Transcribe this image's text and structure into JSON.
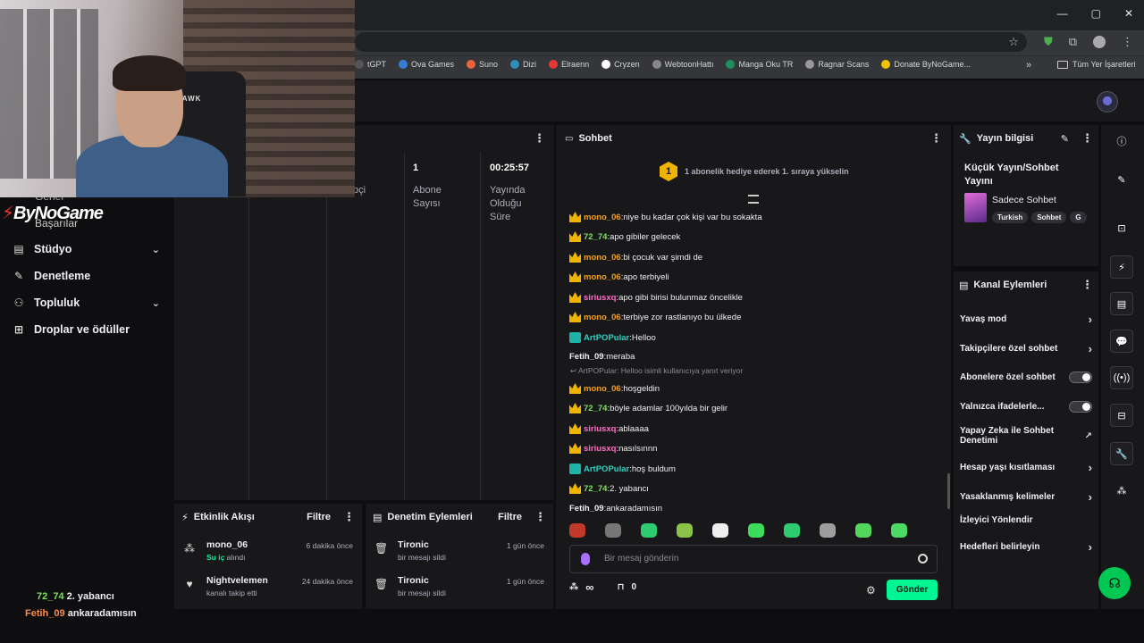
{
  "browser": {
    "win_controls": [
      "—",
      "▢",
      "✕"
    ],
    "bookmarks": [
      {
        "label": "tGPT",
        "color": "#555"
      },
      {
        "label": "Ova Games",
        "color": "#3a7bd5"
      },
      {
        "label": "Suno",
        "color": "#e8643c"
      },
      {
        "label": "Dizi",
        "color": "#2a8fbd"
      },
      {
        "label": "Elraenn",
        "color": "#e53935"
      },
      {
        "label": "Cryzen",
        "color": "#ffffff"
      },
      {
        "label": "WebtoonHattı",
        "color": "#888"
      },
      {
        "label": "Manga Oku TR",
        "color": "#1e8f5e"
      },
      {
        "label": "Ragnar Scans",
        "color": "#999"
      },
      {
        "label": "Donate ByNoGame...",
        "color": "#f2c200"
      }
    ],
    "more": "»",
    "all_bookmarks": "Tüm Yer İşaretleri"
  },
  "webcam": {
    "chair_text": "HAWK"
  },
  "sidebar": {
    "logo": "ByNoGame",
    "cutoff_top": "Genel",
    "cutoff_label": "Başarılar",
    "items": [
      {
        "label": "Stüdyo",
        "icon": "film-icon",
        "glyph": "▤",
        "expand": true
      },
      {
        "label": "Denetleme",
        "icon": "wrench-icon",
        "glyph": "🔧",
        "expand": false
      },
      {
        "label": "Topluluk",
        "icon": "people-icon",
        "glyph": "👥",
        "expand": true
      },
      {
        "label": "Droplar ve ödüller",
        "icon": "gift-icon",
        "glyph": "🎁",
        "expand": false
      }
    ]
  },
  "stats": {
    "col1_label": "pçi",
    "subs_value": "1",
    "subs_label": [
      "Abone",
      "Sayısı"
    ],
    "time_value": "00:25:57",
    "time_label": [
      "Yayında",
      "Olduğu",
      "Süre"
    ]
  },
  "chat": {
    "title": "Sohbet",
    "hype_level": "1",
    "hype_text": "1 abonelik hediye ederek 1. sıraya yükselin",
    "messages": [
      {
        "user": "mono_06",
        "color": "#f0a020",
        "badge": "crown",
        "text": "niye bu kadar çok kişi var bu sokakta"
      },
      {
        "user": "72_74",
        "color": "#7ee35a",
        "badge": "crown",
        "text": "apo gibiler gelecek"
      },
      {
        "user": "mono_06",
        "color": "#f0a020",
        "badge": "crown",
        "text": "bi çocuk var şimdi de"
      },
      {
        "user": "mono_06",
        "color": "#f0a020",
        "badge": "crown",
        "text": "apo terbiyeli"
      },
      {
        "user": "siriusxq",
        "color": "#ff6ec7",
        "badge": "crown",
        "text": "apo gibi birisi bulunmaz öncelikle"
      },
      {
        "user": "mono_06",
        "color": "#f0a020",
        "badge": "crown",
        "text": "terbiye zor rastlanıyo bu ülkede"
      },
      {
        "user": "ArtPOPular",
        "color": "#29d3c6",
        "badge": "artist",
        "text": "Helloo"
      },
      {
        "user": "Fetih_09",
        "color": "#efeff1",
        "badge": "",
        "text": "meraba"
      },
      {
        "user": "mono_06",
        "color": "#f0a020",
        "badge": "crown",
        "text": "hoşgeldin"
      },
      {
        "user": "72_74",
        "color": "#7ee35a",
        "badge": "crown",
        "text": "böyle adamlar 100yılda bir gelir"
      },
      {
        "user": "siriusxq",
        "color": "#ff6ec7",
        "badge": "crown",
        "text": "ablaaaa"
      },
      {
        "user": "siriusxq",
        "color": "#ff6ec7",
        "badge": "crown",
        "text": "nasılsınnn"
      },
      {
        "user": "ArtPOPular",
        "color": "#29d3c6",
        "badge": "artist",
        "text": "hoş buldum"
      },
      {
        "user": "72_74",
        "color": "#7ee35a",
        "badge": "crown",
        "text": "2. yabancı"
      },
      {
        "user": "Fetih_09",
        "color": "#efeff1",
        "badge": "",
        "text": "ankaradamısın"
      }
    ],
    "reply_hint": "↩ ArtPOPular: Helloo isimli kullanıcıya yanıt veriyor",
    "emote_colors": [
      "#c0392b",
      "#777",
      "#2ecc71",
      "#8bc34a",
      "#eeeeee",
      "#3ddc5a",
      "#2ecc71",
      "#9e9e9e",
      "#52d65c",
      "#4cd964"
    ],
    "input_placeholder": "Bir mesaj gönderin",
    "points": "∞",
    "drops": "0",
    "send_label": "Gönder"
  },
  "stream_info": {
    "title": "Yayın bilgisi",
    "stream_title": "Küçük Yayın/Sohbet Yayını",
    "category": "Sadece Sohbet",
    "tags": [
      "Turkish",
      "Sohbet",
      "G"
    ]
  },
  "channel_actions": {
    "title": "Kanal Eylemleri",
    "items": [
      {
        "label": "Yavaş mod",
        "control": "chevron"
      },
      {
        "label": "Takipçilere özel sohbet",
        "control": "chevron"
      },
      {
        "label": "Abonelere özel sohbet",
        "control": "toggle"
      },
      {
        "label": "Yalnızca ifadelerle...",
        "control": "toggle"
      },
      {
        "label": "Yapay Zeka ile Sohbet Denetimi",
        "control": "external"
      },
      {
        "label": "Hesap yaşı kısıtlaması",
        "control": "chevron"
      },
      {
        "label": "Yasaklanmış kelimeler",
        "control": "chevron"
      },
      {
        "label": "İzleyici Yönlendir",
        "control": "none"
      },
      {
        "label": "Hedefleri belirleyin",
        "control": "chevron"
      }
    ]
  },
  "activity": {
    "title": "Etkinlik Akışı",
    "filter": "Filtre",
    "items": [
      {
        "name": "mono_06",
        "sub_highlight": "Su iç",
        "sub": " alındı",
        "time": "6 dakika önce"
      },
      {
        "name": "Nightvelemen",
        "sub_highlight": "",
        "sub": "kanalı takip etti",
        "time": "24 dakika önce"
      }
    ]
  },
  "moderation": {
    "title": "Denetim Eylemleri",
    "filter": "Filtre",
    "items": [
      {
        "name": "Tironic",
        "sub": "bir mesajı sildi",
        "time": "1 gün önce"
      },
      {
        "name": "Tironic",
        "sub": "bir mesajı sildi",
        "time": "1 gün önce"
      }
    ]
  },
  "overlay_chat": [
    {
      "user": "72_74",
      "color": "#7ee35a",
      "text": "2. yabancı"
    },
    {
      "user": "Fetih_09",
      "color": "#ff8c42",
      "text": "ankaradamısın"
    }
  ],
  "rail": {
    "buttons": [
      "ⓘ",
      "✎",
      "⊡",
      "⚡",
      "▤",
      "💬",
      "((•))",
      "⊟",
      "🔧",
      "⁂"
    ],
    "help": "☊"
  }
}
